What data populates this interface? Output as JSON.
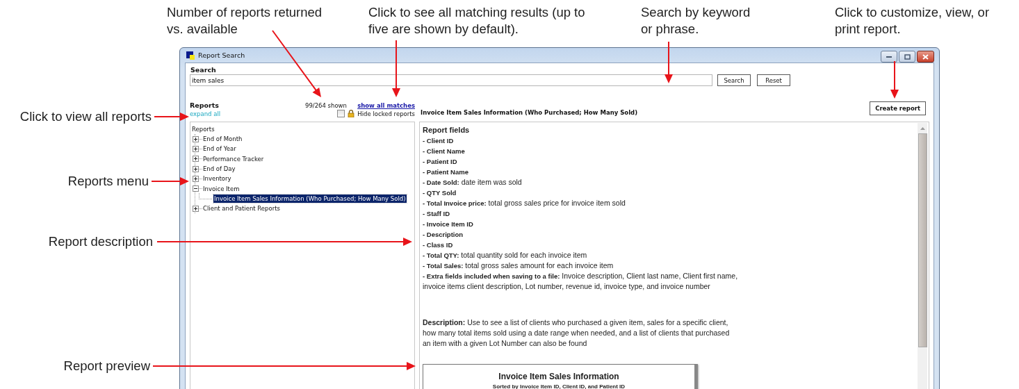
{
  "callouts": [
    {
      "text": "Number of reports returned\nvs. available"
    },
    {
      "text": "Click to see all matching results (up to\nfive are shown by default)."
    },
    {
      "text": "Search by keyword\nor phrase."
    },
    {
      "text": "Click to customize, view, or\nprint report."
    },
    {
      "text": "Click to view all reports"
    },
    {
      "text": "Reports menu"
    },
    {
      "text": "Report description"
    },
    {
      "text": "Report preview"
    }
  ],
  "window": {
    "title": "Report Search"
  },
  "search": {
    "label": "Search",
    "value": "item sales",
    "buttons": [
      "Search",
      "Reset"
    ]
  },
  "reports_panel": {
    "heading": "Reports",
    "expand_link": "expand all",
    "count": "99/264 shown",
    "show_all_link": "show all matches",
    "hide_locked": {
      "label": "Hide locked reports",
      "checked": false
    }
  },
  "report_title": "Invoice Item Sales Information (Who Purchased; How Many Sold)",
  "create_button": "Create report",
  "tree": {
    "label": "Reports",
    "children": [
      {
        "label": "End of Month",
        "expanded": false,
        "selected": false
      },
      {
        "label": "End of Year",
        "expanded": false,
        "selected": false
      },
      {
        "label": "Performance Tracker",
        "expanded": false,
        "selected": false
      },
      {
        "label": "End of Day",
        "expanded": false,
        "selected": false
      },
      {
        "label": "Inventory",
        "expanded": false,
        "selected": false
      },
      {
        "label": "Invoice Item",
        "expanded": true,
        "selected": false,
        "children": [
          {
            "label": "Invoice Item Sales Information (Who Purchased; How Many Sold)",
            "selected": true
          }
        ]
      },
      {
        "label": "Client and Patient Reports",
        "expanded": false,
        "selected": false
      }
    ]
  },
  "details": {
    "heading": "Report fields",
    "fields": [
      {
        "kind": "name",
        "text": "- Client ID"
      },
      {
        "kind": "name",
        "text": "- Client Name"
      },
      {
        "kind": "name",
        "text": "- Patient ID"
      },
      {
        "kind": "name",
        "text": "- Patient Name"
      },
      {
        "kind": "described",
        "text": "**- Date Sold:** date item was sold"
      },
      {
        "kind": "name",
        "text": "- QTY Sold"
      },
      {
        "kind": "described",
        "text": "**- Total Invoice price:** total gross sales price for invoice item sold"
      },
      {
        "kind": "name",
        "text": "- Staff ID"
      },
      {
        "kind": "name",
        "text": "- Invoice Item ID"
      },
      {
        "kind": "name",
        "text": "- Description"
      },
      {
        "kind": "name",
        "text": "- Class ID"
      },
      {
        "kind": "described",
        "text": "**- Total QTY:**  total quantity sold for each invoice item"
      },
      {
        "kind": "described",
        "text": "**- Total Sales:**  total gross sales amount for each invoice item"
      },
      {
        "kind": "described",
        "text": "**- Extra fields included when saving to a file:** Invoice description, Client last name, Client first name, invoice items client description, Lot number, revenue id, invoice type, and  invoice number"
      }
    ],
    "description": "**Description:** Use to see a list of clients who purchased a given item, sales for a specific client, how many total items sold using a date range when needed, and a list of clients that purchased an item with a given Lot Number can also be found",
    "preview": {
      "title": "Invoice Item Sales Information",
      "subtitle": "Sorted by Invoice Item ID, Client ID, and Patient ID"
    }
  }
}
